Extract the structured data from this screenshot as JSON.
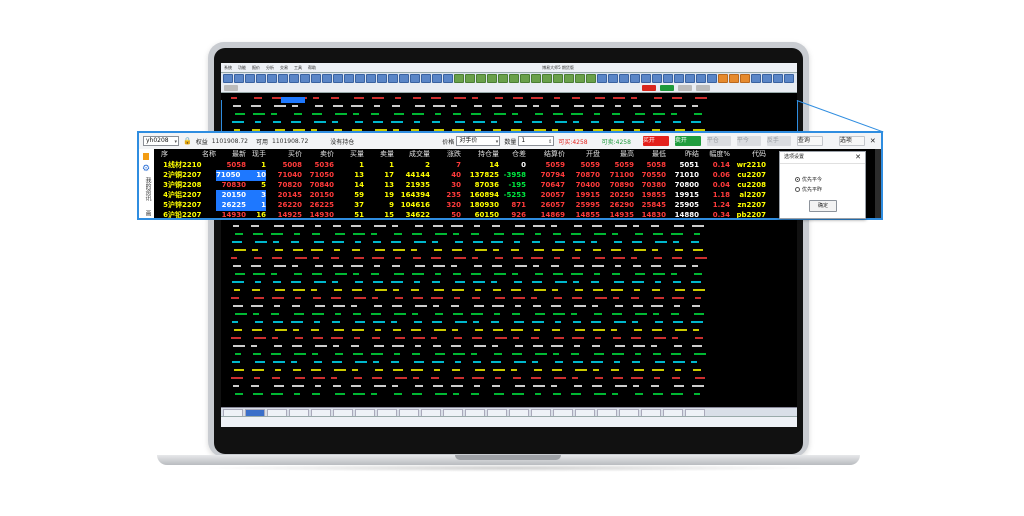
{
  "zoom_panel": {
    "account": "yh0208",
    "equity_label": "权益",
    "equity_value": "1101908.72",
    "available_label": "可用",
    "available_value": "1101908.72",
    "no_position": "没有持仓",
    "price_label": "价格",
    "price_value": "对手价",
    "qty_label": "数量",
    "qty_value": "1",
    "can_open_buy": "可买:4258",
    "can_open_sell": "可卖:4258",
    "buy_open": "买开",
    "sell_open": "卖开",
    "close_pos": "平仓",
    "close_today": "平今",
    "lock": "反手",
    "query": "查询",
    "options": "选项",
    "sidebar_labels": [
      "我的资讯",
      "画"
    ],
    "headers": [
      "序",
      "名称",
      "最新",
      "现手",
      "买价",
      "卖价",
      "买量",
      "卖量",
      "成交量",
      "涨跌",
      "持仓量",
      "仓差",
      "结算价",
      "开盘",
      "最高",
      "最低",
      "昨结",
      "幅度%",
      "代码"
    ],
    "rows": [
      [
        "1",
        "线材2210",
        "5058",
        "1",
        "5008",
        "5036",
        "1",
        "1",
        "2",
        "7",
        "14",
        "0",
        "5059",
        "5059",
        "5059",
        "5058",
        "5051",
        "0.14",
        "wr2210"
      ],
      [
        "2",
        "沪铜2207",
        "71050",
        "10",
        "71040",
        "71050",
        "13",
        "17",
        "44144",
        "40",
        "137825",
        "-3958",
        "70794",
        "70870",
        "71100",
        "70550",
        "71010",
        "0.06",
        "cu2207"
      ],
      [
        "3",
        "沪铜2208",
        "70830",
        "5",
        "70820",
        "70840",
        "14",
        "13",
        "21935",
        "30",
        "87036",
        "-195",
        "70647",
        "70400",
        "70890",
        "70380",
        "70800",
        "0.04",
        "cu2208"
      ],
      [
        "4",
        "沪铝2207",
        "20150",
        "3",
        "20145",
        "20150",
        "59",
        "19",
        "164394",
        "235",
        "160894",
        "-5253",
        "20057",
        "19915",
        "20250",
        "19855",
        "19915",
        "1.18",
        "al2207"
      ],
      [
        "5",
        "沪锌2207",
        "26225",
        "1",
        "26220",
        "26225",
        "37",
        "9",
        "104616",
        "320",
        "180930",
        "871",
        "26057",
        "25995",
        "26290",
        "25845",
        "25905",
        "1.24",
        "zn2207"
      ],
      [
        "6",
        "沪铅2207",
        "14930",
        "16",
        "14925",
        "14930",
        "51",
        "15",
        "34622",
        "50",
        "60150",
        "926",
        "14869",
        "14855",
        "14935",
        "14830",
        "14880",
        "0.34",
        "pb2207"
      ]
    ]
  },
  "dialog": {
    "title": "选项设置",
    "option1": "优先平今",
    "option2": "优先平昨",
    "ok": "确定"
  },
  "screen": {
    "menu_items": [
      "系统",
      "功能",
      "报价",
      "分析",
      "交易",
      "工具",
      "帮助"
    ],
    "title": "博易大师5 期货版"
  }
}
